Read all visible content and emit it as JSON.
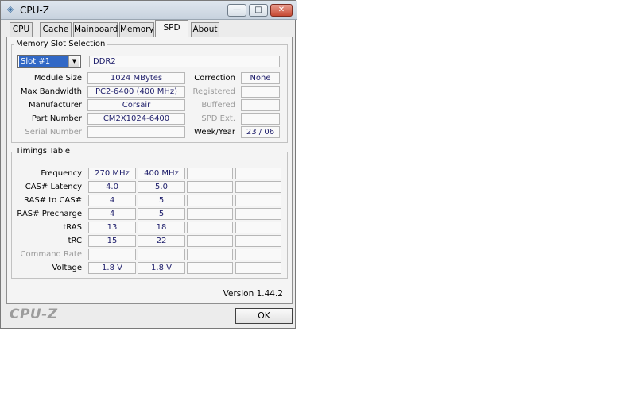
{
  "window": {
    "title": "CPU-Z",
    "minimize": "—",
    "maximize": "□",
    "close": "✕",
    "app_icon": "cpu-z-icon"
  },
  "tabs": [
    "CPU",
    "Cache",
    "Mainboard",
    "Memory",
    "SPD",
    "About"
  ],
  "active_tab": "SPD",
  "memory_slot": {
    "title": "Memory Slot Selection",
    "slot": "Slot #1",
    "type": "DDR2",
    "module_size_label": "Module Size",
    "module_size": "1024 MBytes",
    "max_bandwidth_label": "Max Bandwidth",
    "max_bandwidth": "PC2-6400 (400 MHz)",
    "manufacturer_label": "Manufacturer",
    "manufacturer": "Corsair",
    "part_number_label": "Part Number",
    "part_number": "CM2X1024-6400",
    "serial_number_label": "Serial Number",
    "serial_number": "",
    "correction_label": "Correction",
    "correction": "None",
    "registered_label": "Registered",
    "registered": "",
    "buffered_label": "Buffered",
    "buffered": "",
    "spd_ext_label": "SPD Ext.",
    "spd_ext": "",
    "week_year_label": "Week/Year",
    "week_year": "23 / 06"
  },
  "timings": {
    "title": "Timings Table",
    "rows": [
      {
        "label": "Frequency",
        "values": [
          "270 MHz",
          "400 MHz",
          "",
          ""
        ],
        "dim": false
      },
      {
        "label": "CAS# Latency",
        "values": [
          "4.0",
          "5.0",
          "",
          ""
        ],
        "dim": false
      },
      {
        "label": "RAS# to CAS#",
        "values": [
          "4",
          "5",
          "",
          ""
        ],
        "dim": false
      },
      {
        "label": "RAS# Precharge",
        "values": [
          "4",
          "5",
          "",
          ""
        ],
        "dim": false
      },
      {
        "label": "tRAS",
        "values": [
          "13",
          "18",
          "",
          ""
        ],
        "dim": false
      },
      {
        "label": "tRC",
        "values": [
          "15",
          "22",
          "",
          ""
        ],
        "dim": false
      },
      {
        "label": "Command Rate",
        "values": [
          "",
          "",
          "",
          ""
        ],
        "dim": true
      },
      {
        "label": "Voltage",
        "values": [
          "1.8 V",
          "1.8 V",
          "",
          ""
        ],
        "dim": false
      }
    ]
  },
  "version": "Version 1.44.2",
  "footer": {
    "logo": "CPU-Z",
    "ok": "OK"
  }
}
